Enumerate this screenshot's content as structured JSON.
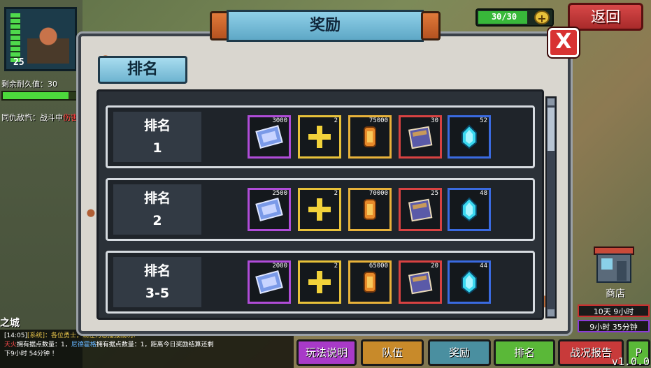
{
  "hud": {
    "level": "25",
    "durability_label": "剩余耐久值：30",
    "durability_fraction": 0.85,
    "enemy_prefix": "同仇敌忾：战斗中",
    "enemy_highlight": "伤害",
    "energy_text": "30/30",
    "energy_fraction": 1.0,
    "energy_plus": "+",
    "back_label": "返回"
  },
  "modal": {
    "title": "奖励",
    "close_label": "X",
    "tab_label": "排名"
  },
  "ranks": [
    {
      "label_top": "排名",
      "label_bottom": "1",
      "rewards": [
        {
          "qty": "3000",
          "icon": "ticket-icon"
        },
        {
          "qty": "2",
          "icon": "plus-icon"
        },
        {
          "qty": "75000",
          "icon": "coin-icon"
        },
        {
          "qty": "30",
          "icon": "book-icon"
        },
        {
          "qty": "52",
          "icon": "crystal-icon"
        }
      ]
    },
    {
      "label_top": "排名",
      "label_bottom": "2",
      "rewards": [
        {
          "qty": "2500",
          "icon": "ticket-icon"
        },
        {
          "qty": "2",
          "icon": "plus-icon"
        },
        {
          "qty": "70000",
          "icon": "coin-icon"
        },
        {
          "qty": "25",
          "icon": "book-icon"
        },
        {
          "qty": "48",
          "icon": "crystal-icon"
        }
      ]
    },
    {
      "label_top": "排名",
      "label_bottom": "3-5",
      "rewards": [
        {
          "qty": "2000",
          "icon": "ticket-icon"
        },
        {
          "qty": "2",
          "icon": "plus-icon"
        },
        {
          "qty": "65000",
          "icon": "coin-icon"
        },
        {
          "qty": "20",
          "icon": "book-icon"
        },
        {
          "qty": "44",
          "icon": "crystal-icon"
        }
      ]
    }
  ],
  "chat": {
    "line1_time": "[14:05]",
    "line1_sys": "[系统]",
    "line1_text": "：各位勇士，现在为您播报战况：",
    "line2_red": "天火",
    "line2_text": "拥有据点数量：1，",
    "line2_blue": "尼德霍格",
    "line2_text2": "拥有据点数量：1，距离今日奖励结算还剩",
    "line3": "下9小时 54分钟 ！"
  },
  "city_label": "之城",
  "shop": {
    "label": "商店",
    "timer1": "10天 9小时",
    "timer2": "9小时 35分钟"
  },
  "bottom_nav": {
    "help": "玩法说明",
    "team": "队伍",
    "reward": "奖励",
    "rank": "排名",
    "report": "战况报告",
    "p": "P"
  },
  "version": "v1.0.0",
  "colors": {
    "purple_border": "#b04cd8",
    "yellow_border": "#e8c23a",
    "red_border": "#d84242",
    "blue_border": "#3a6ae0",
    "back_red": "#d84848"
  }
}
